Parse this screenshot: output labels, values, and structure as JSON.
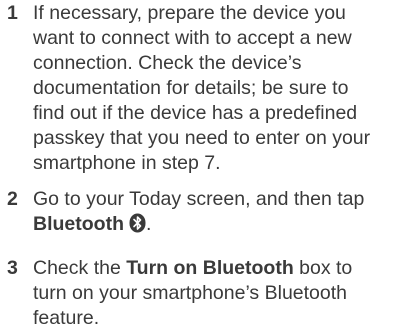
{
  "steps": [
    {
      "number": "1",
      "lines": [
        "If necessary, prepare the device you",
        "want to connect with to accept a new",
        "connection. Check the device’s",
        "documentation for details; be sure to",
        "find out if the device has a predefined",
        "passkey that you need to enter on your",
        "smartphone in step 7."
      ]
    },
    {
      "number": "2",
      "line1": "Go to your Today screen, and then tap",
      "bold_label": "Bluetooth",
      "icon": "bluetooth-icon",
      "period": "."
    },
    {
      "number": "3",
      "prefix": "Check the ",
      "bold_label": "Turn on Bluetooth",
      "suffix": " box to",
      "lines": [
        "turn on your smartphone’s Bluetooth",
        "feature."
      ]
    }
  ],
  "colors": {
    "text": "#3a3a3a",
    "icon_bg": "#3a3a3a",
    "icon_fg": "#ffffff"
  }
}
